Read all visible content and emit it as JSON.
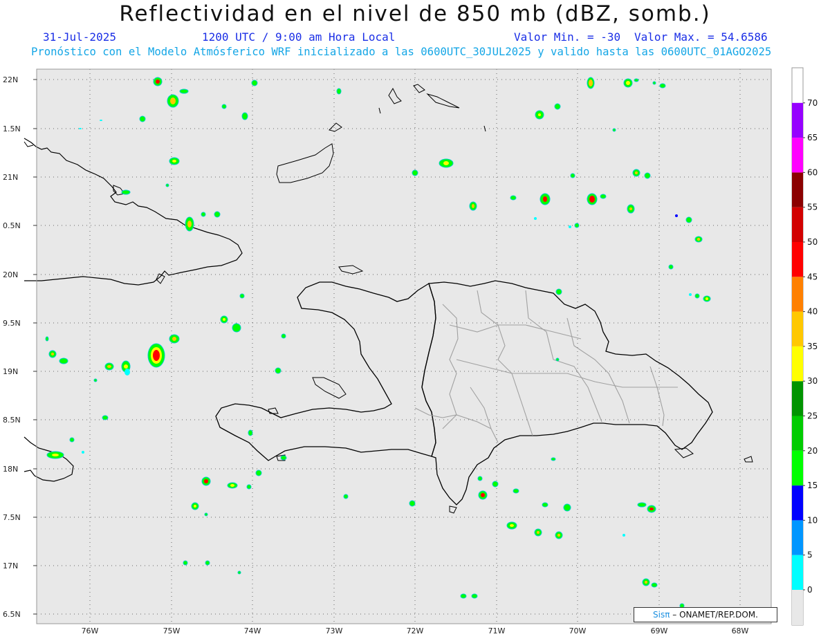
{
  "header": {
    "title": "Reflectividad en el nivel de 850 mb (dBZ, somb.)",
    "date": "31-Jul-2025",
    "time": "1200 UTC / 9:00 am Hora Local",
    "min_label": "Valor Min. = -30",
    "max_label": "Valor Max. = 54.6586",
    "forecast_note": "Pronóstico con el Modelo Atmósferico WRF inicializado a las 0600UTC_30JUL2025 y valido hasta las  0600UTC_01AGO2025"
  },
  "map": {
    "lon_labels": [
      "76W",
      "75W",
      "74W",
      "73W",
      "72W",
      "71W",
      "70W",
      "69W",
      "68W"
    ],
    "lat_labels": [
      "22N",
      "1.5N",
      "21N",
      "0.5N",
      "20N",
      "9.5N",
      "19N",
      "8.5N",
      "18N",
      "7.5N",
      "17N",
      "6.5N"
    ],
    "background_color": "#e8e8e8",
    "coast_color": "#000000",
    "province_color": "#a0a0a0"
  },
  "colorbar": {
    "labels": [
      "0",
      "5",
      "10",
      "15",
      "20",
      "25",
      "30",
      "35",
      "40",
      "45",
      "50",
      "55",
      "60",
      "65",
      "70"
    ],
    "colors": [
      "#00ffff",
      "#0096ff",
      "#0000ff",
      "#00ff00",
      "#00cc00",
      "#009400",
      "#ffff00",
      "#ffc800",
      "#ff8000",
      "#ff0000",
      "#d20000",
      "#8b0000",
      "#ff00ff",
      "#9600ff",
      "#ffffff"
    ]
  },
  "credit": {
    "brand": "Sisπ",
    "org": " – ONAMET/REP.DOM."
  }
}
